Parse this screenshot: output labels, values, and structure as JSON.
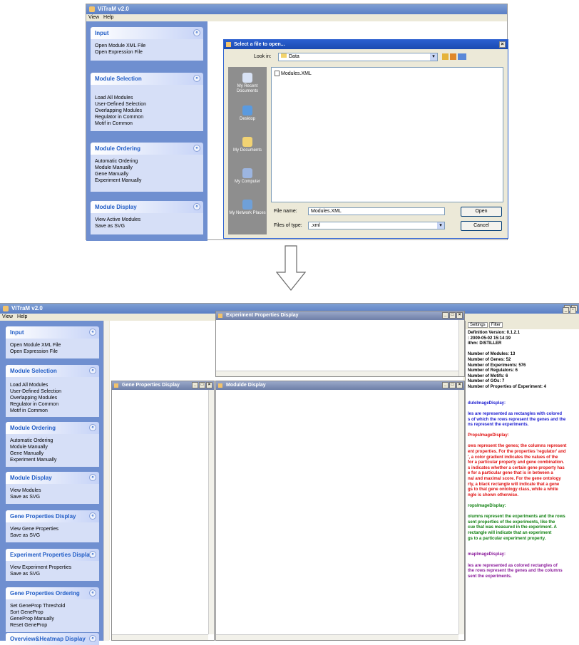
{
  "top": {
    "app_title": "ViTraM  v2.0",
    "menu": [
      "View",
      "Help"
    ],
    "groups": [
      {
        "title": "Input",
        "items": [
          "Open Module XML File",
          "Open Expression File"
        ]
      },
      {
        "title": "Module Selection",
        "items": [
          "Load All Modules",
          "User-Defined Selection",
          "Overlapping Modules",
          "Regulator in Common",
          "Motif in Common"
        ]
      },
      {
        "title": "Module Ordering",
        "items": [
          "Automatic Ordering",
          "Module Manually",
          "Gene Manually",
          "Experiment Manually"
        ]
      },
      {
        "title": "Module Display",
        "items": [
          "View Active Modules",
          "Save as SVG"
        ]
      }
    ],
    "dialog": {
      "title": "Select a file to open...",
      "look_in_label": "Look in:",
      "look_in_value": "Data",
      "file_item": "Modules.XML",
      "places": [
        "My Recent Documents",
        "Desktop",
        "My Documents",
        "My Computer",
        "My Network Places"
      ],
      "file_name_label": "File name:",
      "file_name_value": "Modules.XML",
      "files_of_type_label": "Files of type:",
      "files_of_type_value": ".xml",
      "open_label": "Open",
      "cancel_label": "Cancel"
    }
  },
  "bottom": {
    "app_title": "ViTraM  v2.0",
    "menu": [
      "View",
      "Help"
    ],
    "groups": [
      {
        "title": "Input",
        "items": [
          "Open Module XML File",
          "Open Expression File"
        ]
      },
      {
        "title": "Module Selection",
        "items": [
          "Load All Modules",
          "User-Defined Selection",
          "Overlapping Modules",
          "Regulator in Common",
          "Motif in Common"
        ]
      },
      {
        "title": "Module Ordering",
        "items": [
          "Automatic Ordering",
          "Module Manually",
          "Gene Manually",
          "Experiment Manually"
        ]
      },
      {
        "title": "Module Display",
        "items": [
          "View Modules",
          "Save as SVG"
        ]
      },
      {
        "title": "Gene Properties Display",
        "items": [
          "View Gene Properties",
          "Save as SVG"
        ]
      },
      {
        "title": "Experiment Properties Display",
        "items": [
          "View Experiment Properties",
          "Save as SVG"
        ]
      },
      {
        "title": "Gene Properties Ordering",
        "items": [
          "Set GeneProp Threshold",
          "Sort GeneProp",
          "GeneProp Manually",
          "Reset GeneProp"
        ]
      },
      {
        "title": "Overview&Heatmap Display",
        "items": []
      }
    ],
    "windows": {
      "experiment": "Experiment Properties Display",
      "gene": "Gene Properties Display",
      "module": "Modulde Display"
    },
    "info_tabs": [
      "Settings",
      "Filter"
    ],
    "info_lines": [
      {
        "t": "Definition Version: 0.1.2.1",
        "c": ""
      },
      {
        "t": ": 2009-05-02 15:14:19",
        "c": ""
      },
      {
        "t": "ithm: DISTILLER",
        "c": ""
      },
      {
        "t": "",
        "c": ""
      },
      {
        "t": "Number of Modules: 13",
        "c": ""
      },
      {
        "t": "Number of Genes: 52",
        "c": ""
      },
      {
        "t": "Number of Experiments: 576",
        "c": ""
      },
      {
        "t": "Number of Regulators: 6",
        "c": ""
      },
      {
        "t": "Number of Motifs: 6",
        "c": ""
      },
      {
        "t": "Number of GOs: 7",
        "c": ""
      },
      {
        "t": "Number of Properties of Experiment: 4",
        "c": ""
      },
      {
        "t": "",
        "c": ""
      },
      {
        "t": "",
        "c": ""
      },
      {
        "t": "duleImageDisplay:",
        "c": "blue"
      },
      {
        "t": "",
        "c": ""
      },
      {
        "t": "les are represented as rectangles with colored",
        "c": "blue"
      },
      {
        "t": "s of which the rows represent the genes and the",
        "c": "blue"
      },
      {
        "t": "ns represent the experiments.",
        "c": "blue"
      },
      {
        "t": "",
        "c": ""
      },
      {
        "t": "PropsImageDisplay:",
        "c": "red"
      },
      {
        "t": "",
        "c": ""
      },
      {
        "t": "ows represent the genes; the columns represent",
        "c": "red"
      },
      {
        "t": "ent properties. For the properties 'regulator' and",
        "c": "red"
      },
      {
        "t": "', a color gradient indicates the values of the",
        "c": "red"
      },
      {
        "t": "for a particular property and gene combination.",
        "c": "red"
      },
      {
        "t": "s indicates whether a certain gene property has",
        "c": "red"
      },
      {
        "t": "e for a particular gene that is in between a",
        "c": "red"
      },
      {
        "t": "nal and maximal score. For the gene ontology",
        "c": "red"
      },
      {
        "t": "rty, a black rectangle will indicate that a gene",
        "c": "red"
      },
      {
        "t": "gs to that gene ontology class, while a white",
        "c": "red"
      },
      {
        "t": "ngle is shown otherwise.",
        "c": "red"
      },
      {
        "t": "",
        "c": ""
      },
      {
        "t": "ropsImageDisplay:",
        "c": "green"
      },
      {
        "t": "",
        "c": ""
      },
      {
        "t": "olumns represent the experiments and the rows",
        "c": "green"
      },
      {
        "t": "sent properties of the experiments, like the",
        "c": "green"
      },
      {
        "t": "cue that was measured in the experiment. A",
        "c": "green"
      },
      {
        "t": "rectangle will indicate that an experiment",
        "c": "green"
      },
      {
        "t": "gs to a particular experiment property.",
        "c": "green"
      },
      {
        "t": "",
        "c": ""
      },
      {
        "t": "",
        "c": ""
      },
      {
        "t": "mapImageDisplay:",
        "c": "purple"
      },
      {
        "t": "",
        "c": ""
      },
      {
        "t": "les are represented as colored rectangles of",
        "c": "purple"
      },
      {
        "t": "the rows represent the genes and the columns",
        "c": "purple"
      },
      {
        "t": "sent the experiments.",
        "c": "purple"
      }
    ]
  }
}
